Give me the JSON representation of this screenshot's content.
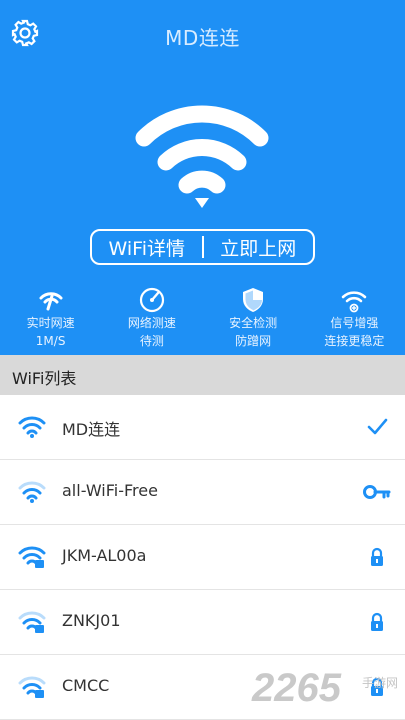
{
  "header": {
    "title": "MD连连"
  },
  "actions": {
    "details_label": "WiFi详情",
    "connect_label": "立即上网"
  },
  "features": [
    {
      "icon": "signal-speed-icon",
      "line1": "实时网速",
      "line2": "1M/S"
    },
    {
      "icon": "speedometer-icon",
      "line1": "网络测速",
      "line2": "待测"
    },
    {
      "icon": "shield-icon",
      "line1": "安全检测",
      "line2": "防蹭网"
    },
    {
      "icon": "wifi-boost-icon",
      "line1": "信号增强",
      "line2": "连接更稳定"
    }
  ],
  "list": {
    "header": "WiFi列表",
    "networks": [
      {
        "ssid": "MD连连",
        "status": "connected",
        "status_icon": "checkmark-icon"
      },
      {
        "ssid": "all-WiFi-Free",
        "status": "saved",
        "status_icon": "key-icon"
      },
      {
        "ssid": "JKM-AL00a",
        "status": "locked",
        "status_icon": "lock-icon"
      },
      {
        "ssid": "ZNKJ01",
        "status": "locked",
        "status_icon": "lock-icon"
      },
      {
        "ssid": "CMCC",
        "status": "locked",
        "status_icon": "lock-icon"
      }
    ]
  },
  "watermark": {
    "brand": "2265",
    "site": "手游网"
  },
  "colors": {
    "primary": "#1e90f5",
    "list_header_bg": "#d9d9d9",
    "icon_blue": "#1e90f5"
  }
}
